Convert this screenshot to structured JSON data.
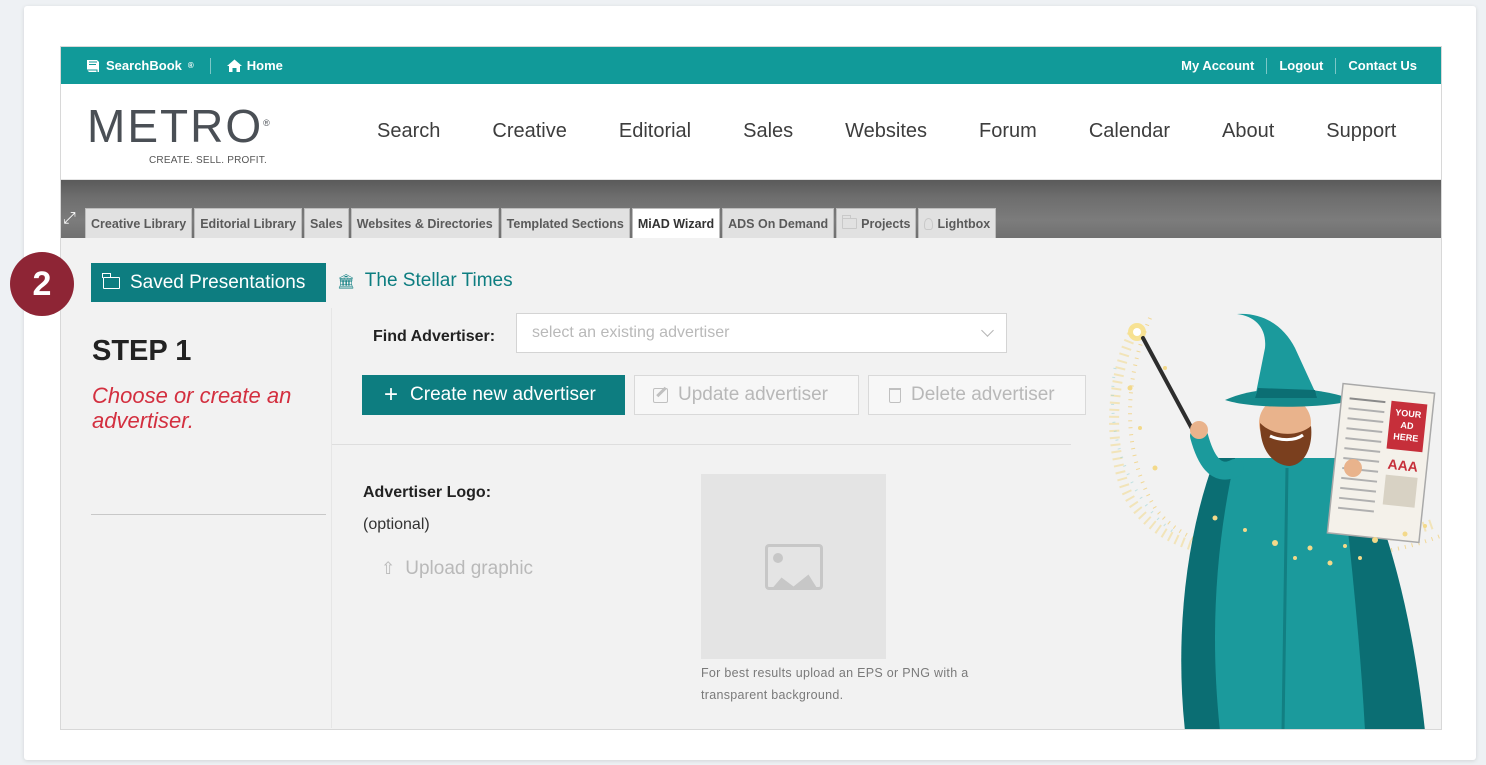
{
  "topbar": {
    "searchbook": "SearchBook",
    "registered": "®",
    "home": "Home",
    "my_account": "My Account",
    "logout": "Logout",
    "contact_us": "Contact Us"
  },
  "logo": {
    "word": "METRO",
    "registered": "®",
    "tagline": "CREATE. SELL. PROFIT."
  },
  "nav": [
    "Search",
    "Creative",
    "Editorial",
    "Sales",
    "Websites",
    "Forum",
    "Calendar",
    "About",
    "Support"
  ],
  "tabs": [
    {
      "label": "Creative Library",
      "icon": ""
    },
    {
      "label": "Editorial Library",
      "icon": ""
    },
    {
      "label": "Sales",
      "icon": ""
    },
    {
      "label": "Websites & Directories",
      "icon": ""
    },
    {
      "label": "Templated Sections",
      "icon": ""
    },
    {
      "label": "MiAD Wizard",
      "icon": "",
      "active": true
    },
    {
      "label": "ADS On Demand",
      "icon": ""
    },
    {
      "label": "Projects",
      "icon": "folder-icon"
    },
    {
      "label": "Lightbox",
      "icon": "lightbulb-icon"
    }
  ],
  "content": {
    "saved_presentations": "Saved Presentations",
    "publication": "The Stellar Times",
    "step_title": "STEP 1",
    "step_desc": "Choose or create an advertiser.",
    "find_label": "Find Advertiser:",
    "find_placeholder": "select an existing advertiser",
    "create_btn": "Create new advertiser",
    "update_btn": "Update advertiser",
    "delete_btn": "Delete advertiser",
    "logo_label": "Advertiser Logo:",
    "logo_optional": "(optional)",
    "upload": "Upload graphic",
    "hint": "For best results upload an EPS or PNG with a transparent background."
  },
  "wizard_newspaper": {
    "line1": "YOUR",
    "line2": "AD",
    "line3": "HERE",
    "sign": "AAA"
  },
  "badge": "2",
  "colors": {
    "teal": "#119a99",
    "teal_dark": "#0d7d80",
    "red": "#d32f3f",
    "badge": "#8e2535"
  }
}
